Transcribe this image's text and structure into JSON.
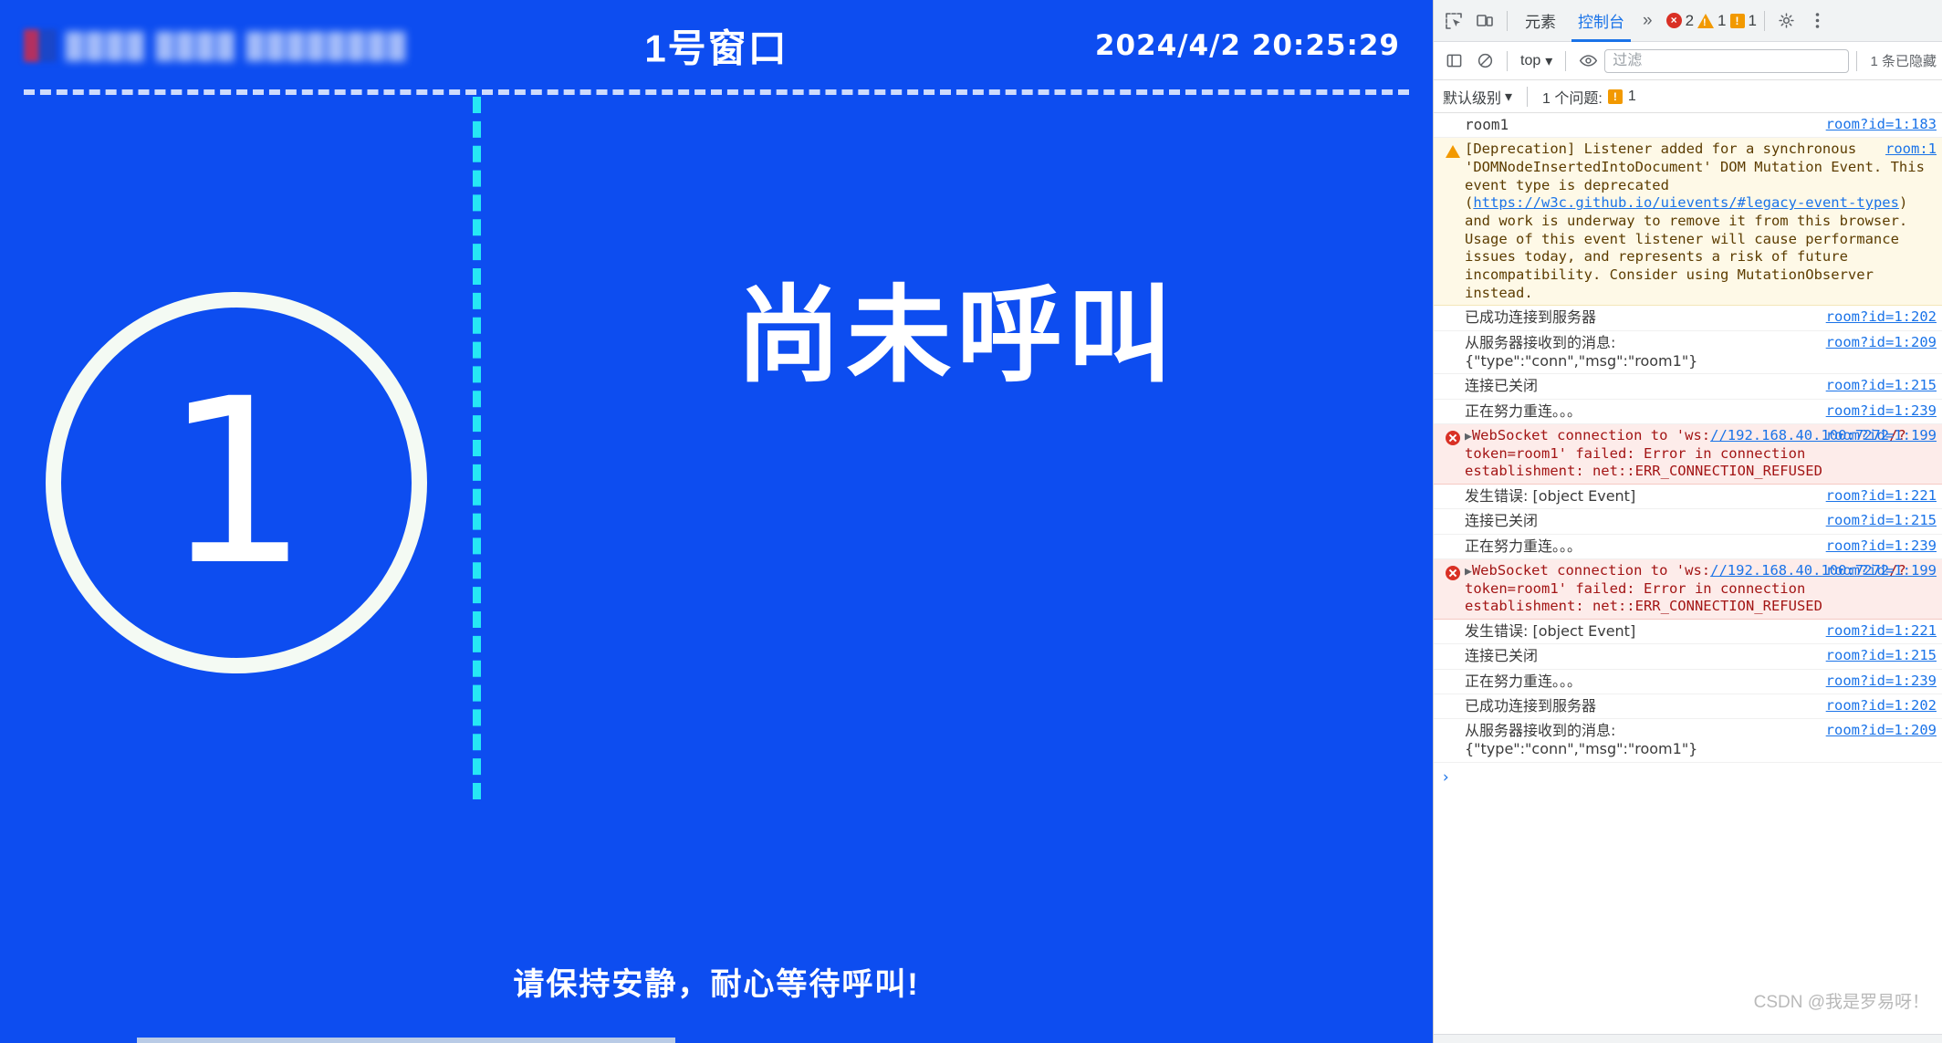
{
  "page": {
    "brand_text_redacted": "████ ████ ████████",
    "header_title": "1号窗口",
    "clock": "2024/4/2  20:25:29",
    "ring_number": "1",
    "status_text": "尚未呼叫",
    "footer_text": "请保持安静，耐心等待呼叫!",
    "colors": {
      "background": "#0d4df0",
      "ring": "#f4faf3",
      "divider": "#26e7f5",
      "text": "#ffffff"
    }
  },
  "devtools": {
    "tabbar": {
      "inspect_icon": "inspect-element-icon",
      "device_icon": "device-toolbar-icon",
      "tabs": [
        {
          "label": "元素",
          "active": false
        },
        {
          "label": "控制台",
          "active": true
        }
      ],
      "more_label": "»",
      "counters": {
        "errors": "2",
        "warnings": "1",
        "infos": "1"
      },
      "settings_icon": "gear-icon",
      "menu_icon": "kebab-menu-icon"
    },
    "filterbar": {
      "sidebar_icon": "show-console-sidebar-icon",
      "clear_icon": "clear-console-icon",
      "context": "top",
      "eye_icon": "live-expression-icon",
      "filter_value": "",
      "filter_placeholder": "过滤",
      "hidden_note": "1 条已隐藏"
    },
    "levelbar": {
      "level_label": "默认级别",
      "issues_label": "1 个问题:",
      "issues_count": "1"
    },
    "console_messages": [
      {
        "type": "log",
        "text": "room1",
        "source": "room?id=1:183",
        "mono": true
      },
      {
        "type": "warn",
        "text": "[Deprecation] Listener added for a synchronous 'DOMNodeInsertedIntoDocument' DOM Mutation Event. This event type is deprecated (https://w3c.github.io/uievents/#legacy-event-types) and work is underway to remove it from this browser. Usage of this event listener will cause performance issues today, and represents a risk of future incompatibility. Consider using MutationObserver instead.",
        "link_text": "https://w3c.github.io/uievents/#legacy-event-types",
        "source": "room:1"
      },
      {
        "type": "log",
        "text": "已成功连接到服务器",
        "source": "room?id=1:202"
      },
      {
        "type": "log",
        "text": "从服务器接收到的消息:\n{\"type\":\"conn\",\"msg\":\"room1\"}",
        "source": "room?id=1:209"
      },
      {
        "type": "log",
        "text": "连接已关闭",
        "source": "room?id=1:215"
      },
      {
        "type": "log",
        "text": "正在努力重连。。。",
        "source": "room?id=1:239"
      },
      {
        "type": "error",
        "text": "WebSocket connection to 'ws://192.168.40.100:7272/?token=room1' failed: Error in connection establishment: net::ERR_CONNECTION_REFUSED",
        "link_text": "//192.168.40.100:7272",
        "source": "room?id=1:199",
        "expandable": true
      },
      {
        "type": "log",
        "text": "发生错误: [object Event]",
        "source": "room?id=1:221"
      },
      {
        "type": "log",
        "text": "连接已关闭",
        "source": "room?id=1:215"
      },
      {
        "type": "log",
        "text": "正在努力重连。。。",
        "source": "room?id=1:239"
      },
      {
        "type": "error",
        "text": "WebSocket connection to 'ws://192.168.40.100:7272/?token=room1' failed: Error in connection establishment: net::ERR_CONNECTION_REFUSED",
        "link_text": "//192.168.40.100:7272",
        "source": "room?id=1:199",
        "expandable": true
      },
      {
        "type": "log",
        "text": "发生错误: [object Event]",
        "source": "room?id=1:221"
      },
      {
        "type": "log",
        "text": "连接已关闭",
        "source": "room?id=1:215"
      },
      {
        "type": "log",
        "text": "正在努力重连。。。",
        "source": "room?id=1:239"
      },
      {
        "type": "log",
        "text": "已成功连接到服务器",
        "source": "room?id=1:202"
      },
      {
        "type": "log",
        "text": "从服务器接收到的消息:\n{\"type\":\"conn\",\"msg\":\"room1\"}",
        "source": "room?id=1:209"
      }
    ],
    "prompt_symbol": "›",
    "watermark": "CSDN @我是罗易呀！"
  }
}
